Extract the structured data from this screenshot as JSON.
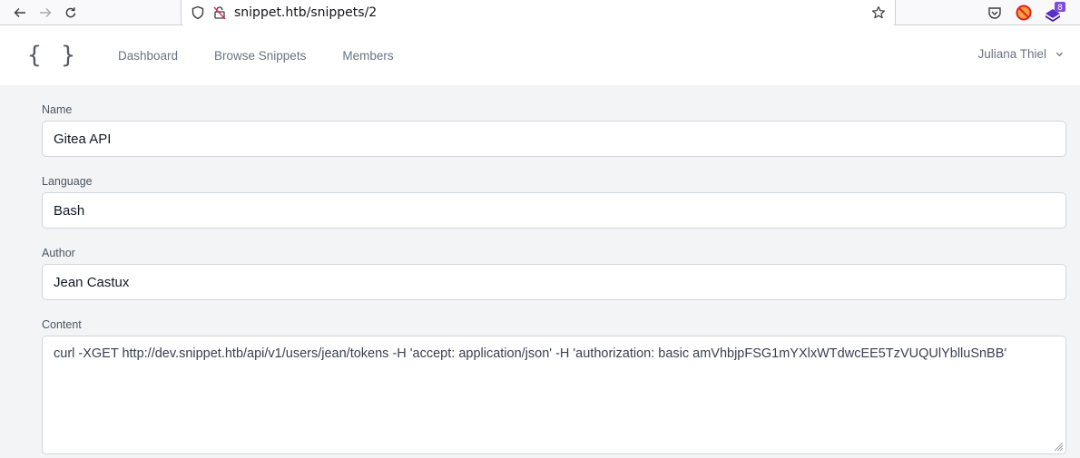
{
  "browser": {
    "url": "snippet.htb/snippets/2",
    "extensions": [
      {
        "name": "pocket-icon"
      },
      {
        "name": "blocker-extension-icon"
      },
      {
        "name": "extension-badge-icon",
        "badge": "8",
        "color": "#5b2fc9"
      }
    ]
  },
  "navbar": {
    "logo": "{ }",
    "links": [
      "Dashboard",
      "Browse Snippets",
      "Members"
    ],
    "user": "Juliana Thiel"
  },
  "form": {
    "name": {
      "label": "Name",
      "value": "Gitea API"
    },
    "language": {
      "label": "Language",
      "value": "Bash"
    },
    "author": {
      "label": "Author",
      "value": "Jean Castux"
    },
    "content": {
      "label": "Content",
      "value": "curl -XGET http://dev.snippet.htb/api/v1/users/jean/tokens -H 'accept: application/json' -H 'authorization: basic amVhbjpFSG1mYXlxWTdwcEE5TzVUQUlYblluSnBB'"
    }
  }
}
